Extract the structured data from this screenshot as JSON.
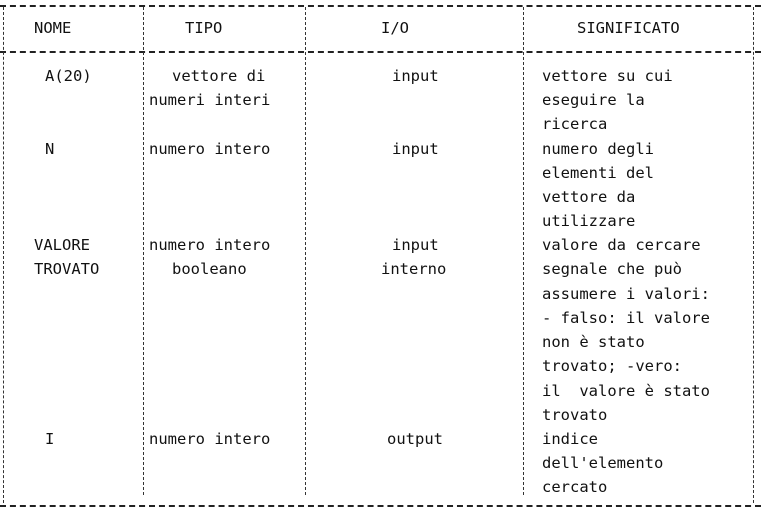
{
  "table": {
    "headers": [
      "NOME",
      "TIPO",
      "I/O",
      "SIGNIFICATO"
    ],
    "rows": [
      {
        "nome": [
          "A(20)"
        ],
        "tipo": [
          "vettore di",
          "numeri interi"
        ],
        "io": [
          "input"
        ],
        "significato": [
          "vettore su cui",
          "eseguire la",
          "ricerca"
        ]
      },
      {
        "nome": [
          "N"
        ],
        "tipo": [
          "numero intero"
        ],
        "io": [
          "input"
        ],
        "significato": [
          "numero degli",
          "elementi del",
          "vettore da",
          "utilizzare"
        ]
      },
      {
        "nome": [
          "VALORE",
          "TROVATO"
        ],
        "tipo": [
          "numero intero",
          "booleano"
        ],
        "io": [
          "input",
          "interno"
        ],
        "significato": [
          "valore da cercare",
          "segnale che può",
          "assumere i valori:",
          "- falso: il valore",
          "non è stato",
          "trovato; -vero:",
          "il  valore è stato",
          "trovato"
        ]
      },
      {
        "nome": [
          "I"
        ],
        "tipo": [
          "numero intero"
        ],
        "io": [
          "output"
        ],
        "significato": [
          "indice",
          "dell'elemento",
          "cercato"
        ]
      }
    ]
  }
}
